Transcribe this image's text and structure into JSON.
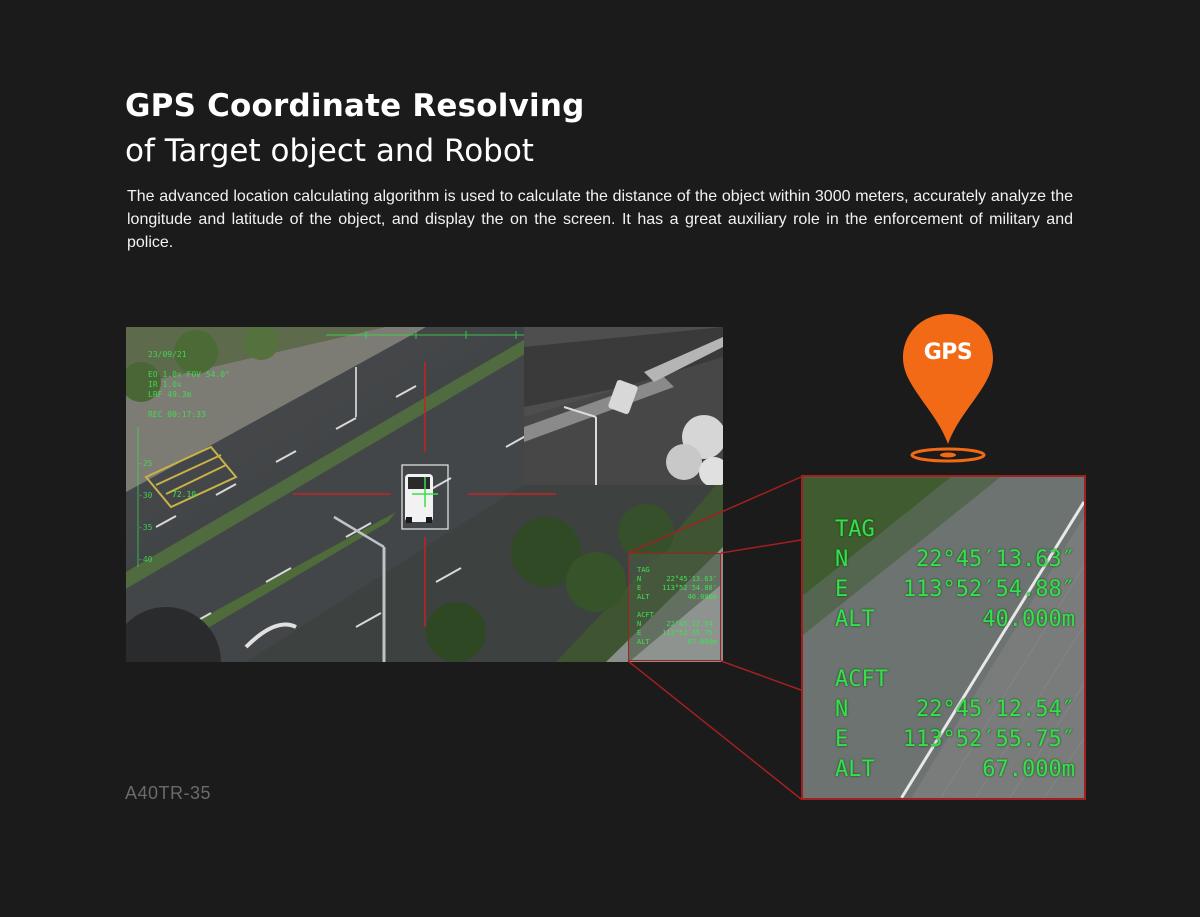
{
  "heading": {
    "title_bold": "GPS Coordinate Resolving",
    "title_light": "of Target object and Robot"
  },
  "description": "The advanced location calculating algorithm is used to calculate the distance of the object within 3000 meters, accurately analyze the longitude and latitude of the object, and display the on the screen. It has a great auxiliary role in the enforcement of military and police.",
  "model_label": "A40TR-35",
  "gps_badge": "GPS",
  "colors": {
    "background": "#1b1b1b",
    "accent_orange": "#f26a16",
    "hud_green": "#36e04a",
    "frame_red": "#a32020"
  },
  "hud": {
    "date": "23/09/21",
    "eo": "EO  1.0x FOV 54.0°",
    "ir": "IR  1.0x",
    "lrf": "LRF 49.3m",
    "time": "REC 00:17:33",
    "scale_ticks": [
      "-25",
      "-30",
      "-35",
      "-40"
    ],
    "distance": "72.10"
  },
  "target": {
    "tag_label": "TAG",
    "n_label": "N",
    "n_value": "22°45′13.63″",
    "e_label": "E",
    "e_value": "113°52′54.88″",
    "alt_label": "ALT",
    "alt_value": "40.000m"
  },
  "aircraft": {
    "tag_label": "ACFT",
    "n_label": "N",
    "n_value": "22°45′12.54″",
    "e_label": "E",
    "e_value": "113°52′55.75″",
    "alt_label": "ALT",
    "alt_value": "67.000m"
  }
}
